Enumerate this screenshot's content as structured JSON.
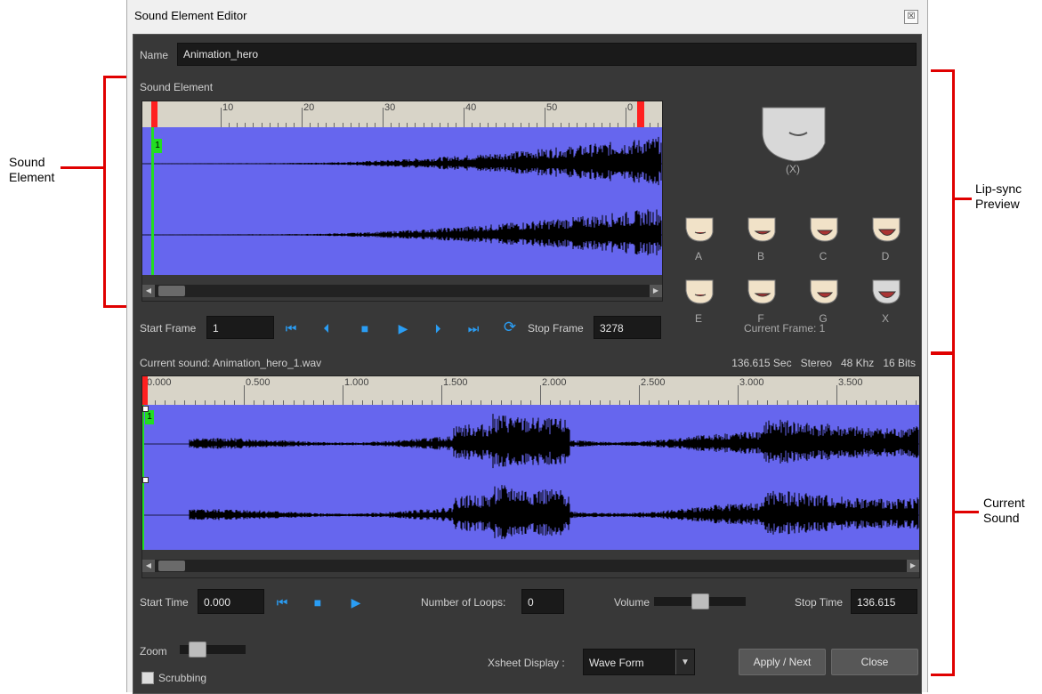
{
  "callouts": {
    "sound_element": "Sound\nElement",
    "lip_sync": "Lip-sync\nPreview",
    "current_sound": "Current\nSound"
  },
  "window": {
    "title": "Sound Element Editor",
    "close_glyph": "☒"
  },
  "name_row": {
    "label": "Name",
    "value": "Animation_hero"
  },
  "sound_element": {
    "section_label": "Sound Element",
    "ruler_labels": [
      "10",
      "20",
      "30",
      "40",
      "50",
      "0"
    ],
    "frame_marker": "1",
    "start_frame_label": "Start Frame",
    "start_frame_value": "1",
    "stop_frame_label": "Stop Frame",
    "stop_frame_value": "3278"
  },
  "lip_sync": {
    "big_label": "(X)",
    "mouths": [
      "A",
      "B",
      "C",
      "D",
      "E",
      "F",
      "G",
      "X"
    ],
    "current_frame": "Current Frame: 1"
  },
  "current_sound": {
    "label": "Current sound: Animation_hero_1.wav",
    "info": "136.615 Sec   Stereo   48 Khz   16 Bits",
    "ruler_labels": [
      "0.000",
      "0.500",
      "1.000",
      "1.500",
      "2.000",
      "2.500",
      "3.000",
      "3.500"
    ],
    "frame_marker": "1",
    "start_time_label": "Start Time",
    "start_time_value": "0.000",
    "loops_label": "Number of Loops:",
    "loops_value": "0",
    "volume_label": "Volume",
    "stop_time_label": "Stop Time",
    "stop_time_value": "136.615"
  },
  "bottom": {
    "zoom_label": "Zoom",
    "scrubbing_label": "Scrubbing",
    "xsheet_label": "Xsheet Display :",
    "xsheet_value": "Wave Form",
    "apply_label": "Apply / Next",
    "close_label": "Close"
  },
  "colors": {
    "accent": "#2a9df4",
    "wave": "#6666ee",
    "marker": "#ff2020",
    "callout": "#e00000"
  }
}
